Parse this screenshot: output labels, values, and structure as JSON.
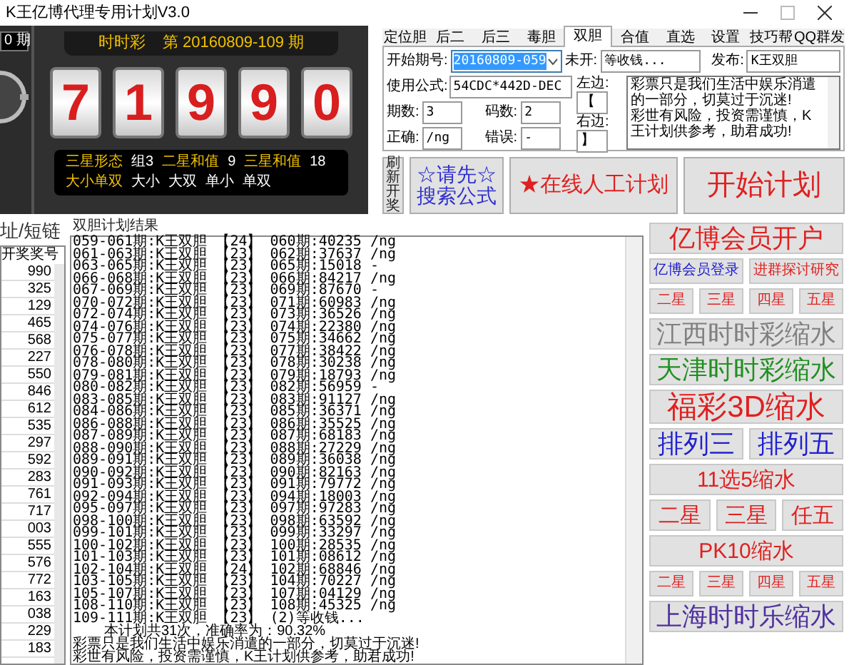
{
  "window": {
    "title": "K王亿博代理专用计划V3.0"
  },
  "left_edge": {
    "period": "0 期"
  },
  "lottery": {
    "name": "时时彩",
    "issue": "第 20160809-109 期",
    "digits": [
      "7",
      "1",
      "9",
      "9",
      "0"
    ],
    "info": [
      [
        {
          "text": "三星形态",
          "kind": "label"
        },
        {
          "text": "组3",
          "kind": "value"
        },
        {
          "text": "二星和值",
          "kind": "label"
        },
        {
          "text": "9",
          "kind": "value"
        },
        {
          "text": "三星和值",
          "kind": "label"
        },
        {
          "text": "18",
          "kind": "value"
        }
      ],
      [
        {
          "text": "大小单双",
          "kind": "label"
        },
        {
          "text": "大小",
          "kind": "value"
        },
        {
          "text": "大双",
          "kind": "value"
        },
        {
          "text": "单小",
          "kind": "value"
        },
        {
          "text": "单双",
          "kind": "value"
        }
      ]
    ]
  },
  "tabs": [
    {
      "label": "定位胆",
      "selected": false
    },
    {
      "label": "后二",
      "selected": false
    },
    {
      "label": "后三",
      "selected": false
    },
    {
      "label": "毒胆",
      "selected": false
    },
    {
      "label": "双胆",
      "selected": true
    },
    {
      "label": "合值",
      "selected": false
    },
    {
      "label": "直选",
      "selected": false
    },
    {
      "label": "设置",
      "selected": false
    },
    {
      "label": "技巧帮",
      "selected": false
    },
    {
      "label": "QQ群发",
      "selected": false
    }
  ],
  "form": {
    "start_issue": {
      "label": "开始期号:",
      "value": "20160809-059"
    },
    "pending": {
      "label": "未开:",
      "value": "等收钱..."
    },
    "publish": {
      "label": "发布:",
      "value": "K王双胆"
    },
    "formula": {
      "label": "使用公式:",
      "value": "54CDC*442D-DEC"
    },
    "periods": {
      "label": "期数:",
      "value": "3"
    },
    "codes": {
      "label": "码数:",
      "value": "2"
    },
    "correct": {
      "label": "正确:",
      "value": "/ng"
    },
    "wrong": {
      "label": "错误:",
      "value": "-"
    },
    "left": {
      "label": "左边:",
      "value": "【"
    },
    "right": {
      "label": "右边:",
      "value": "】"
    },
    "message": "彩票只是我们生活中娱乐消遣的一部分，切莫过于沉迷!\n彩世有风险，投资需谨慎，K王计划供参考，助君成功!"
  },
  "actions": [
    {
      "label": "刷新开奖",
      "kind": "vertical"
    },
    {
      "label": "☆请先☆\n搜索公式",
      "kind": "search"
    },
    {
      "label": "★在线人工计划",
      "kind": "online"
    },
    {
      "label": "开始计划",
      "kind": "start"
    }
  ],
  "history": {
    "title": "址/短链",
    "column": "开奖奖号",
    "rows": [
      "990",
      "325",
      "129",
      "465",
      "568",
      "227",
      "550",
      "846",
      "612",
      "535",
      "297",
      "592",
      "283",
      "761",
      "717",
      "003",
      "555",
      "576",
      "772",
      "163",
      "038",
      "229",
      "183"
    ]
  },
  "results": {
    "title": "双胆计划结果",
    "lines": [
      "059-061期:K王双胆 【24】 060期:40235 /ng",
      "061-063期:K王双胆 【23】 062期:37637 /ng",
      "063-065期:K王双胆 【23】 065期:15018 -",
      "066-068期:K王双胆 【23】 066期:84217 /ng",
      "067-069期:K王双胆 【23】 069期:87670 -",
      "070-072期:K王双胆 【23】 071期:60983 /ng",
      "072-074期:K王双胆 【23】 073期:36526 /ng",
      "074-076期:K王双胆 【23】 074期:22380 /ng",
      "075-077期:K王双胆 【23】 075期:34662 /ng",
      "076-078期:K王双胆 【23】 077期:38422 /ng",
      "078-080期:K王双胆 【23】 078期:30238 /ng",
      "079-081期:K王双胆 【23】 079期:18793 /ng",
      "080-082期:K王双胆 【23】 082期:56959 -",
      "083-085期:K王双胆 【23】 083期:91127 /ng",
      "084-086期:K王双胆 【23】 085期:36371 /ng",
      "086-088期:K王双胆 【23】 086期:35525 /ng",
      "087-089期:K王双胆 【23】 087期:68183 /ng",
      "088-090期:K王双胆 【23】 088期:27229 /ng",
      "089-091期:K王双胆 【23】 089期:36038 /ng",
      "090-092期:K王双胆 【23】 090期:82163 /ng",
      "091-093期:K王双胆 【23】 091期:79772 /ng",
      "092-094期:K王双胆 【23】 094期:18003 /ng",
      "095-097期:K王双胆 【23】 097期:97283 /ng",
      "098-100期:K王双胆 【23】 098期:63592 /ng",
      "099-101期:K王双胆 【23】 099期:33297 /ng",
      "100-102期:K王双胆 【23】 100期:28535 /ng",
      "101-103期:K王双胆 【23】 101期:08612 /ng",
      "102-104期:K王双胆 【24】 102期:68846 /ng",
      "103-105期:K王双胆 【23】 104期:70227 /ng",
      "105-107期:K王双胆 【23】 107期:04129 /ng",
      "108-110期:K王双胆 【23】 108期:45325 /ng",
      "109-111期:K王双胆 【23】 (2)等收钱..."
    ],
    "summary": [
      "本计划共31次，准确率为：90.32%",
      "彩票只是我们生活中娱乐消遣的一部分，切莫过于沉迷!",
      "彩世有风险，投资需谨慎，K王计划供参考，助君成功!"
    ]
  },
  "side_buttons": [
    [
      {
        "label": "亿博会员开户",
        "color": "#e02020",
        "kind": "big"
      }
    ],
    [
      {
        "label": "亿博会员登录",
        "color": "#1a1ad0",
        "kind": "small"
      },
      {
        "label": "进群探讨研究",
        "color": "#e02020",
        "kind": "small"
      }
    ],
    [
      {
        "label": "二星",
        "color": "#e02020",
        "kind": "small"
      },
      {
        "label": "三星",
        "color": "#e02020",
        "kind": "small"
      },
      {
        "label": "四星",
        "color": "#e02020",
        "kind": "small"
      },
      {
        "label": "五星",
        "color": "#e02020",
        "kind": "small"
      }
    ],
    [
      {
        "label": "江西时时彩缩水",
        "color": "#808080",
        "kind": "big"
      }
    ],
    [
      {
        "label": "天津时时彩缩水",
        "color": "#209020",
        "kind": "big"
      }
    ],
    [
      {
        "label": "福彩3D缩水",
        "color": "#e02020",
        "kind": "huge"
      }
    ],
    [
      {
        "label": "排列三",
        "color": "#2020d0",
        "kind": "big"
      },
      {
        "label": "排列五",
        "color": "#2020d0",
        "kind": "big"
      }
    ],
    [
      {
        "label": "11选5缩水",
        "color": "#e02020",
        "kind": "mid"
      }
    ],
    [
      {
        "label": "二星",
        "color": "#e02020",
        "kind": "mid"
      },
      {
        "label": "三星",
        "color": "#e02020",
        "kind": "mid"
      },
      {
        "label": "任五",
        "color": "#e02020",
        "kind": "mid"
      }
    ],
    [
      {
        "label": "PK10缩水",
        "color": "#e02020",
        "kind": "mid"
      }
    ],
    [
      {
        "label": "二星",
        "color": "#e02020",
        "kind": "small"
      },
      {
        "label": "三星",
        "color": "#e02020",
        "kind": "small"
      },
      {
        "label": "四星",
        "color": "#e02020",
        "kind": "small"
      },
      {
        "label": "五星",
        "color": "#e02020",
        "kind": "small"
      }
    ],
    [
      {
        "label": "上海时时乐缩水",
        "color": "#5030a0",
        "kind": "big"
      }
    ]
  ]
}
